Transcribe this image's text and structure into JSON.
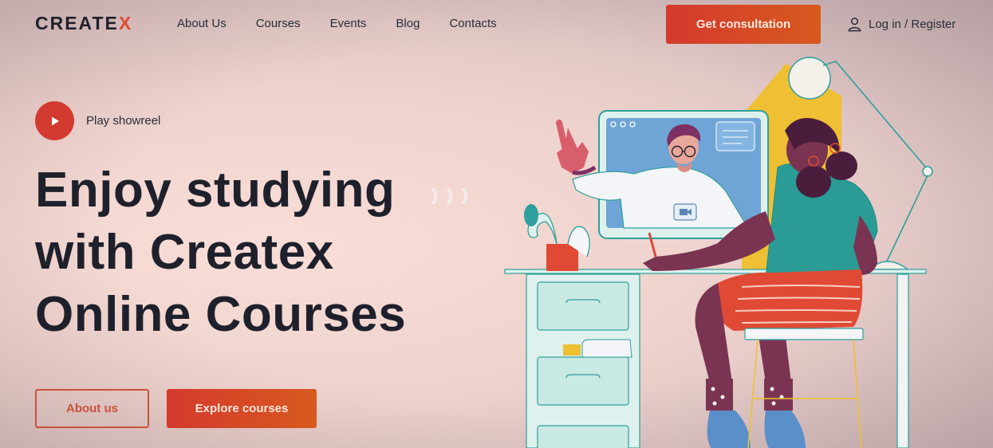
{
  "header": {
    "logo_main": "CREATE",
    "logo_accent": "X",
    "nav": [
      "About Us",
      "Courses",
      "Events",
      "Blog",
      "Contacts"
    ],
    "cta_label": "Get consultation",
    "login_label": "Log in / Register"
  },
  "hero": {
    "play_label": "Play showreel",
    "title_line1": "Enjoy studying",
    "title_line2": "with Createx",
    "title_line3": "Online Courses",
    "about_button": "About us",
    "explore_button": "Explore courses"
  },
  "colors": {
    "accent": "#d4392d",
    "text_dark": "#1e212c",
    "teal": "#2e9f9a",
    "yellow": "#f1c232"
  },
  "icons": {
    "play": "play-icon",
    "user": "user-icon"
  }
}
